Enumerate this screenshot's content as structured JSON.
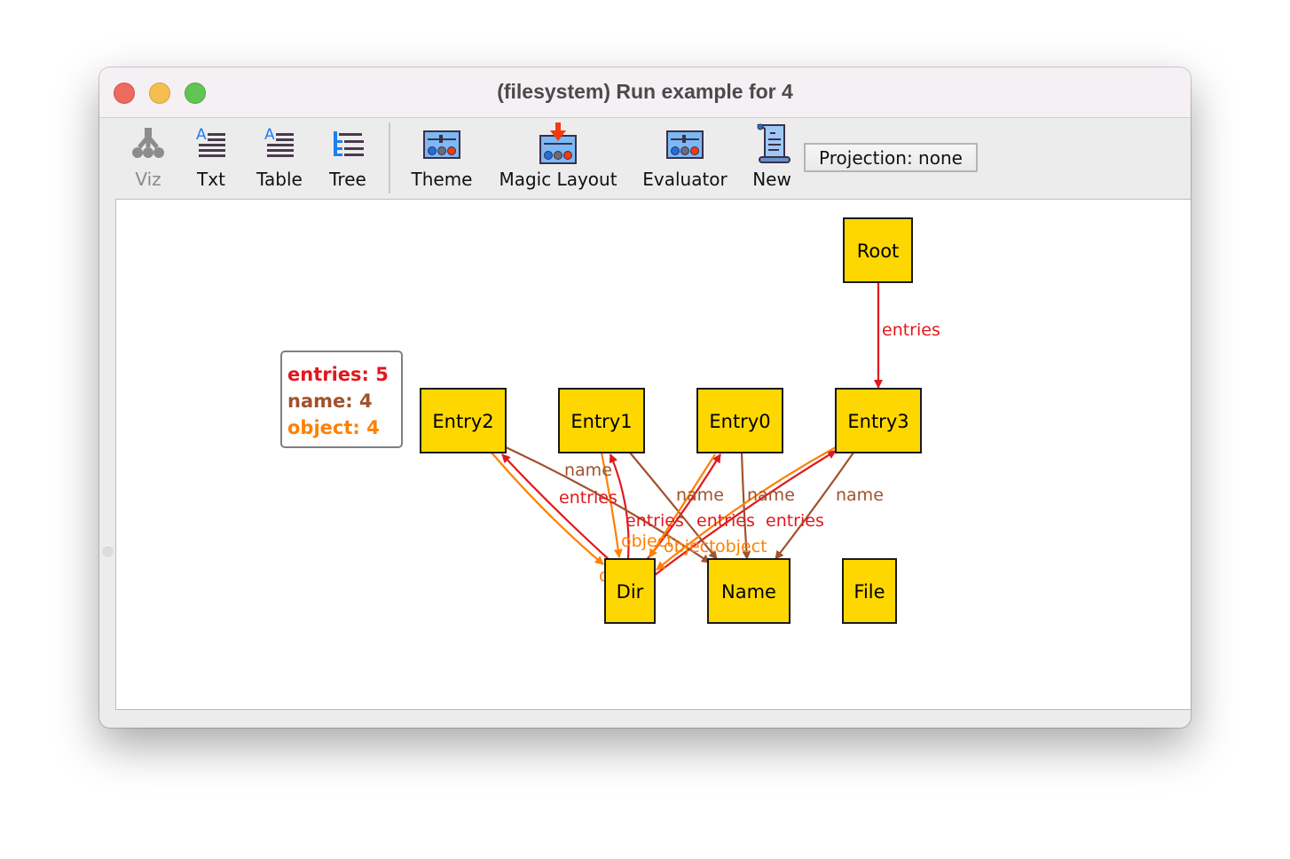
{
  "window": {
    "title": "(filesystem) Run example for 4"
  },
  "toolbar": {
    "items": [
      {
        "label": "Viz",
        "icon": "viz-tree-icon",
        "enabled": false
      },
      {
        "label": "Txt",
        "icon": "text-icon",
        "enabled": true
      },
      {
        "label": "Table",
        "icon": "table-icon",
        "enabled": true
      },
      {
        "label": "Tree",
        "icon": "tree-icon",
        "enabled": true
      },
      {
        "label": "Theme",
        "icon": "theme-sliders-icon",
        "enabled": true
      },
      {
        "label": "Magic Layout",
        "icon": "magic-layout-icon",
        "enabled": true
      },
      {
        "label": "Evaluator",
        "icon": "evaluator-sliders-icon",
        "enabled": true
      },
      {
        "label": "New",
        "icon": "scroll-icon",
        "enabled": true
      }
    ],
    "projection_label": "Projection: none"
  },
  "legend": {
    "items": [
      {
        "label": "entries: 5",
        "color": "#e0181e"
      },
      {
        "label": "name: 4",
        "color": "#a0522d"
      },
      {
        "label": "object: 4",
        "color": "#ff8000"
      }
    ]
  },
  "graph": {
    "colors": {
      "entries": "#e0181e",
      "name": "#a0522d",
      "object": "#ff8000",
      "node_fill": "#ffd700"
    },
    "nodes": [
      {
        "id": "Root",
        "label": "Root"
      },
      {
        "id": "Entry2",
        "label": "Entry2"
      },
      {
        "id": "Entry1",
        "label": "Entry1"
      },
      {
        "id": "Entry0",
        "label": "Entry0"
      },
      {
        "id": "Entry3",
        "label": "Entry3"
      },
      {
        "id": "Dir",
        "label": "Dir"
      },
      {
        "id": "Name",
        "label": "Name"
      },
      {
        "id": "File",
        "label": "File"
      }
    ],
    "edges": [
      {
        "from": "Root",
        "to": "Entry3",
        "relation": "entries",
        "label": "entries"
      },
      {
        "from": "Dir",
        "to": "Entry2",
        "relation": "entries",
        "label": "entries"
      },
      {
        "from": "Dir",
        "to": "Entry1",
        "relation": "entries",
        "label": "entries"
      },
      {
        "from": "Dir",
        "to": "Entry0",
        "relation": "entries",
        "label": "entries"
      },
      {
        "from": "Dir",
        "to": "Entry3",
        "relation": "entries",
        "label": "entries"
      },
      {
        "from": "Entry2",
        "to": "Name",
        "relation": "name",
        "label": "name"
      },
      {
        "from": "Entry1",
        "to": "Name",
        "relation": "name",
        "label": "name"
      },
      {
        "from": "Entry0",
        "to": "Name",
        "relation": "name",
        "label": "name"
      },
      {
        "from": "Entry3",
        "to": "Name",
        "relation": "name",
        "label": "name"
      },
      {
        "from": "Entry2",
        "to": "Dir",
        "relation": "object",
        "label": "object"
      },
      {
        "from": "Entry1",
        "to": "Dir",
        "relation": "object",
        "label": "object"
      },
      {
        "from": "Entry0",
        "to": "Dir",
        "relation": "object",
        "label": "object"
      },
      {
        "from": "Entry3",
        "to": "Dir",
        "relation": "object",
        "label": "object"
      }
    ]
  }
}
